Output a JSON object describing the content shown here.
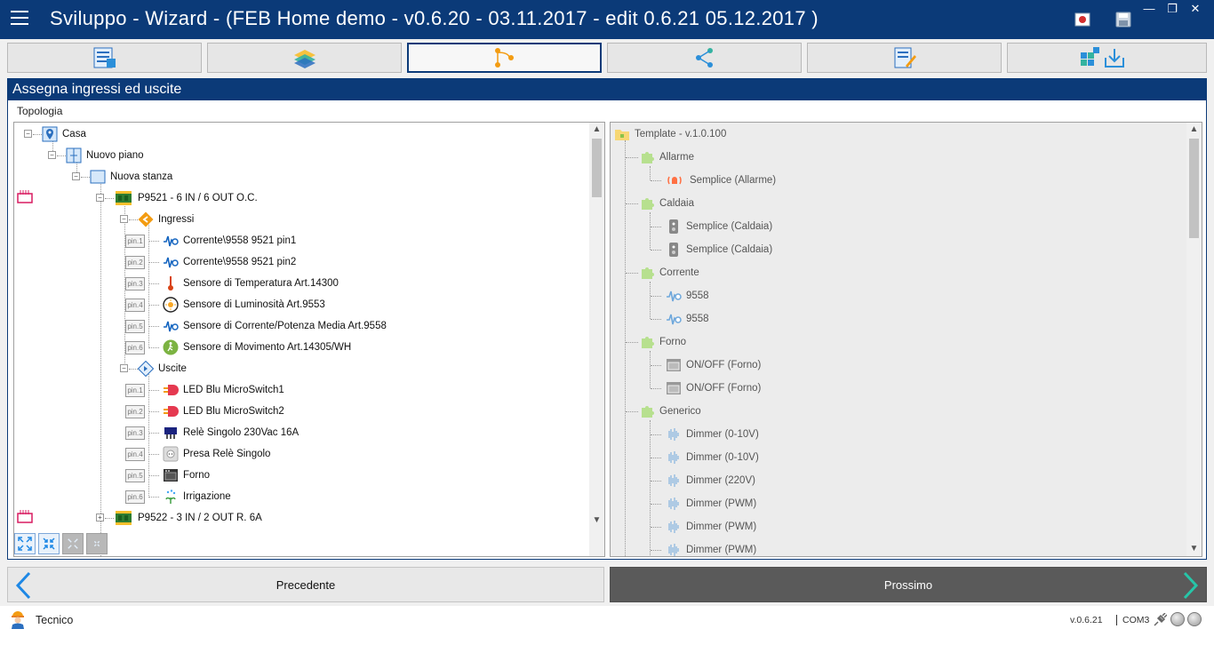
{
  "window": {
    "title": "Sviluppo - Wizard - (FEB Home demo - v0.6.20 - 03.11.2017 - edit 0.6.21 05.12.2017 )",
    "minimize_glyph": "—",
    "restore_glyph": "❐",
    "close_glyph": "✕"
  },
  "steps": [
    {
      "icon": "list-icon"
    },
    {
      "icon": "layers-icon"
    },
    {
      "icon": "topology-icon",
      "active": true
    },
    {
      "icon": "network-icon"
    },
    {
      "icon": "edit-document-icon"
    },
    {
      "icon": "deploy-icon"
    }
  ],
  "panel": {
    "header": "Assegna ingressi ed uscite",
    "section_label": "Topologia"
  },
  "left_tree": {
    "casa": "Casa",
    "piano": "Nuovo piano",
    "stanza": "Nuova stanza",
    "device1": "P9521 - 6 IN / 6 OUT O.C.",
    "ingressi": "Ingressi",
    "inputs": [
      {
        "pin": "pin.1",
        "label": "Corrente\\9558 9521 pin1"
      },
      {
        "pin": "pin.2",
        "label": "Corrente\\9558 9521 pin2"
      },
      {
        "pin": "pin.3",
        "label": "Sensore di Temperatura Art.14300"
      },
      {
        "pin": "pin.4",
        "label": "Sensore di Luminosità Art.9553"
      },
      {
        "pin": "pin.5",
        "label": "Sensore di Corrente/Potenza Media Art.9558"
      },
      {
        "pin": "pin.6",
        "label": "Sensore di Movimento Art.14305/WH"
      }
    ],
    "uscite": "Uscite",
    "outputs": [
      {
        "pin": "pin.1",
        "label": "LED Blu MicroSwitch1"
      },
      {
        "pin": "pin.2",
        "label": "LED Blu MicroSwitch2"
      },
      {
        "pin": "pin.3",
        "label": "Relè Singolo 230Vac 16A"
      },
      {
        "pin": "pin.4",
        "label": "Presa Relè Singolo"
      },
      {
        "pin": "pin.5",
        "label": "Forno"
      },
      {
        "pin": "pin.6",
        "label": "Irrigazione"
      }
    ],
    "device2": "P9522 - 3 IN / 2 OUT R. 6A"
  },
  "right_tree": {
    "root": "Template - v.1.0.100",
    "allarme": "Allarme",
    "allarme_item": "Semplice (Allarme)",
    "caldaia": "Caldaia",
    "caldaia_items": [
      "Semplice (Caldaia)",
      "Semplice (Caldaia)"
    ],
    "corrente": "Corrente",
    "corrente_items": [
      "9558",
      "9558"
    ],
    "forno": "Forno",
    "forno_items": [
      "ON/OFF (Forno)",
      "ON/OFF (Forno)"
    ],
    "generico": "Generico",
    "generico_items": [
      "Dimmer (0-10V)",
      "Dimmer (0-10V)",
      "Dimmer (220V)",
      "Dimmer (PWM)",
      "Dimmer (PWM)",
      "Dimmer (PWM)"
    ]
  },
  "nav": {
    "prev": "Precedente",
    "next": "Prossimo"
  },
  "status": {
    "user": "Tecnico",
    "version": "v.0.6.21",
    "port": "COM3"
  },
  "colors": {
    "accent": "#0b3a78",
    "next_bg": "#5a5a5a",
    "arrow_prev": "#1e88e5",
    "arrow_next": "#26c6a8"
  }
}
